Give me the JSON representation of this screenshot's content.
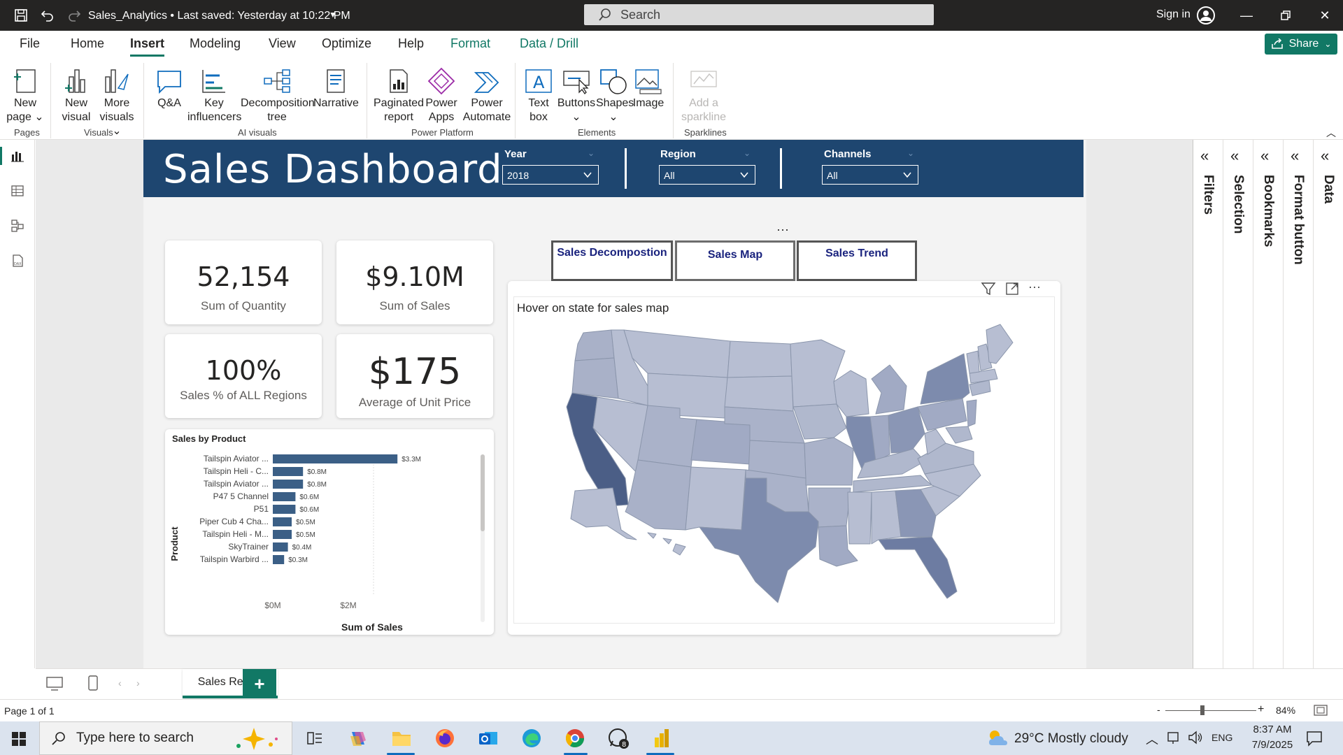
{
  "titlebar": {
    "doc_title": "Sales_Analytics • Last saved: Yesterday at 10:22 PM",
    "search_placeholder": "Search",
    "signin": "Sign in"
  },
  "menu": {
    "tabs": [
      "File",
      "Home",
      "Insert",
      "Modeling",
      "View",
      "Optimize",
      "Help",
      "Format",
      "Data / Drill"
    ],
    "active": "Insert",
    "share_label": "Share"
  },
  "ribbon": {
    "buttons": {
      "new_page": [
        "New",
        "page ⌄"
      ],
      "new_visual": [
        "New",
        "visual"
      ],
      "more_visuals": [
        "More",
        "visuals ⌄"
      ],
      "qa": [
        "Q&A"
      ],
      "key_influencers": [
        "Key",
        "influencers"
      ],
      "decomposition_tree": [
        "Decomposition",
        "tree"
      ],
      "narrative": [
        "Narrative"
      ],
      "paginated_report": [
        "Paginated",
        "report"
      ],
      "power_apps": [
        "Power",
        "Apps"
      ],
      "power_automate": [
        "Power",
        "Automate"
      ],
      "text_box": [
        "Text",
        "box"
      ],
      "buttons": [
        "Buttons",
        "⌄"
      ],
      "shapes": [
        "Shapes",
        "⌄"
      ],
      "image": [
        "Image"
      ],
      "add_sparkline": [
        "Add a",
        "sparkline"
      ]
    },
    "groups": {
      "pages": "Pages",
      "visuals": "Visuals",
      "ai_visuals": "AI visuals",
      "power_platform": "Power Platform",
      "elements": "Elements",
      "sparklines": "Sparklines"
    }
  },
  "dashboard": {
    "title": "Sales Dashboard",
    "slicers": [
      {
        "label": "Year",
        "value": "2018"
      },
      {
        "label": "Region",
        "value": "All"
      },
      {
        "label": "Channels",
        "value": "All"
      }
    ],
    "kpis": [
      {
        "value": "52,154",
        "label": "Sum of Quantity"
      },
      {
        "value": "$9.10M",
        "label": "Sum of Sales"
      },
      {
        "value": "100%",
        "label": "Sales % of ALL Regions"
      },
      {
        "value": "$175",
        "label": "Average of Unit Price"
      }
    ],
    "nav_buttons": [
      "Sales Decompostion",
      "Sales Map",
      "Sales Trend"
    ],
    "map_title": "Hover on state for sales map"
  },
  "chart_data": {
    "type": "bar",
    "orientation": "horizontal",
    "title": "Sales by Product",
    "xlabel": "Sum of Sales",
    "ylabel": "Product",
    "categories": [
      "Tailspin Aviator ...",
      "Tailspin Heli - C...",
      "Tailspin Aviator ...",
      "P47 5 Channel",
      "P51",
      "Piper Cub 4 Cha...",
      "Tailspin Heli - M...",
      "SkyTrainer",
      "Tailspin Warbird ..."
    ],
    "values": [
      3.3,
      0.8,
      0.8,
      0.6,
      0.6,
      0.5,
      0.5,
      0.4,
      0.3
    ],
    "data_labels": [
      "$3.3M",
      "$0.8M",
      "$0.8M",
      "$0.6M",
      "$0.6M",
      "$0.5M",
      "$0.5M",
      "$0.4M",
      "$0.3M"
    ],
    "xticks": [
      "$0M",
      "$2M"
    ],
    "xlim": [
      0,
      4
    ],
    "bar_color": "#3b5f86"
  },
  "rightpanes": [
    "Filters",
    "Selection",
    "Bookmarks",
    "Format button",
    "Data"
  ],
  "pagetabs": {
    "tab": "Sales Report",
    "add": "+"
  },
  "statusbar": {
    "page_info": "Page 1 of 1",
    "zoom": "84%"
  },
  "taskbar": {
    "search_placeholder": "Type here to search",
    "weather": "29°C  Mostly cloudy",
    "lang": "ENG",
    "time": "8:37 AM",
    "date": "7/9/2025",
    "whatsapp_badge": "8"
  },
  "colors": {
    "accent": "#117865",
    "header": "#1e4670",
    "titlebar": "#252423"
  }
}
